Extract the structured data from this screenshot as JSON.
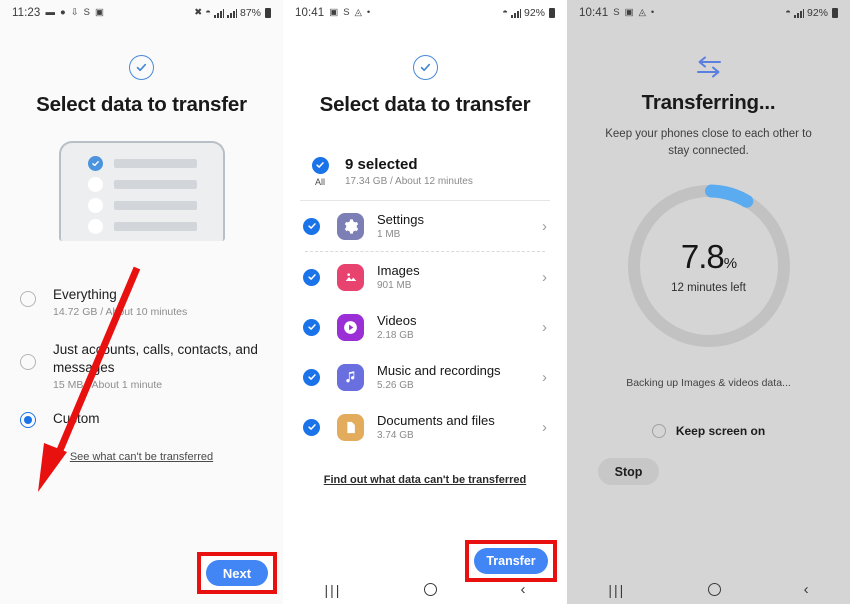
{
  "screen1": {
    "status_bar": {
      "time": "11:23",
      "left_icons": [
        "message-icon",
        "notification-bell-icon",
        "download-icon",
        "s-badge-icon",
        "gallery-icon"
      ],
      "right_icons": [
        "mute-icon",
        "wifi-icon",
        "sim-icon",
        "signal-icon"
      ],
      "battery": "87%"
    },
    "header_icon": "circle-check-icon",
    "title": "Select data to transfer",
    "illustration": {
      "name": "device-checklist-illustration",
      "rows": [
        {
          "checked": true
        },
        {
          "checked": false
        },
        {
          "checked": false
        },
        {
          "checked": false
        }
      ]
    },
    "options": [
      {
        "label": "Everything",
        "sub": "14.72 GB / About 10 minutes",
        "selected": false
      },
      {
        "label": "Just accounts, calls, contacts, and messages",
        "sub": "15 MB / About 1 minute",
        "selected": false
      },
      {
        "label": "Custom",
        "sub": "",
        "selected": true
      }
    ],
    "link": "See what can't be transferred",
    "next_button": "Next",
    "annotation": {
      "type": "red-arrow",
      "color": "#e8110f"
    },
    "highlight_color": "#e8110f"
  },
  "screen2": {
    "status_bar": {
      "time": "10:41",
      "left_icons": [
        "gallery-icon",
        "s-badge-icon",
        "camera-icon",
        "dot-icon"
      ],
      "right_icons": [
        "wifi-icon",
        "signal-icon"
      ],
      "battery": "92%"
    },
    "header_icon": "circle-check-icon",
    "title": "Select data to transfer",
    "select_all": {
      "title": "9 selected",
      "sub": "17.34 GB / About 12 minutes",
      "all_label": "All",
      "checked": true
    },
    "items": [
      {
        "title": "Settings",
        "size": "1 MB",
        "icon": "gear-icon",
        "color": "#7b7fb5",
        "checked": true
      },
      {
        "title": "Images",
        "size": "901 MB",
        "icon": "image-icon",
        "color": "#e8436f",
        "checked": true
      },
      {
        "title": "Videos",
        "size": "2.18 GB",
        "icon": "play-icon",
        "color": "#9b2fd6",
        "checked": true
      },
      {
        "title": "Music and recordings",
        "size": "5.26 GB",
        "icon": "music-note-icon",
        "color": "#6a6fe0",
        "checked": true
      },
      {
        "title": "Documents and files",
        "size": "3.74 GB",
        "icon": "document-icon",
        "color": "#e2ac5c",
        "checked": true
      }
    ],
    "link": "Find out what data can't be transferred",
    "transfer_button": "Transfer",
    "nav": {
      "recents": "|||",
      "home": "home-icon",
      "back": "back-icon"
    }
  },
  "screen3": {
    "status_bar": {
      "time": "10:41",
      "left_icons": [
        "s-badge-icon",
        "gallery-icon",
        "camera-icon",
        "dot-icon"
      ],
      "right_icons": [
        "wifi-icon",
        "signal-icon"
      ],
      "battery": "92%"
    },
    "header_icon": "swap-arrows-icon",
    "title": "Transferring...",
    "subtitle": "Keep your phones close to each other to stay connected.",
    "progress": {
      "percent": "7.8",
      "percent_symbol": "%",
      "value": 7.8,
      "eta": "12 minutes left",
      "arc_color": "#5aabef",
      "track_color": "#c2c2c2"
    },
    "status_text": "Backing up Images & videos data...",
    "keep_screen_on": {
      "label": "Keep screen on",
      "checked": false
    },
    "stop_button": "Stop",
    "nav": {
      "recents": "|||",
      "home": "home-icon",
      "back": "back-icon"
    }
  }
}
